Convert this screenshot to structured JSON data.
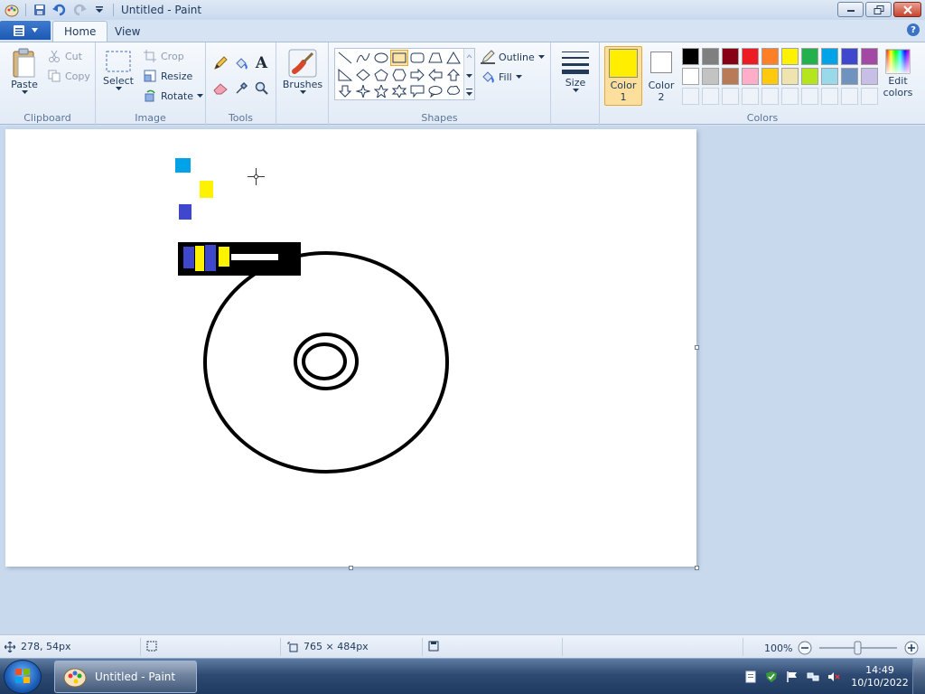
{
  "window": {
    "title": "Untitled - Paint"
  },
  "tabs": {
    "home": "Home",
    "view": "View",
    "help": "?"
  },
  "clipboard": {
    "paste": "Paste",
    "cut": "Cut",
    "copy": "Copy",
    "label": "Clipboard"
  },
  "image": {
    "select": "Select",
    "crop": "Crop",
    "resize": "Resize",
    "rotate": "Rotate",
    "label": "Image"
  },
  "tools": {
    "label": "Tools",
    "text_glyph": "A"
  },
  "brushes": {
    "label": "Brushes"
  },
  "shapes": {
    "outline": "Outline",
    "fill": "Fill",
    "label": "Shapes",
    "selected": "rectangle"
  },
  "size": {
    "label": "Size"
  },
  "colors": {
    "color1_label": "Color",
    "color1_num": "1",
    "color2_label": "Color",
    "color2_num": "2",
    "color1_value": "#ffee00",
    "color2_value": "#ffffff",
    "edit_label_1": "Edit",
    "edit_label_2": "colors",
    "label": "Colors",
    "palette_row1": [
      "#000000",
      "#7f7f7f",
      "#880015",
      "#ed1c24",
      "#ff7f27",
      "#fff200",
      "#22b14c",
      "#00a2e8",
      "#3f48cc",
      "#a349a4"
    ],
    "palette_row2": [
      "#ffffff",
      "#c3c3c3",
      "#b97a57",
      "#ffaec9",
      "#ffc90e",
      "#efe4b0",
      "#b5e61d",
      "#99d9ea",
      "#7092be",
      "#c8bfe7"
    ]
  },
  "status": {
    "cursor_pos": "278, 54px",
    "canvas_size": "765 × 484px",
    "zoom": "100%"
  },
  "taskbar": {
    "app_label": "Untitled - Paint",
    "time": "14:49",
    "date": "10/10/2022"
  }
}
